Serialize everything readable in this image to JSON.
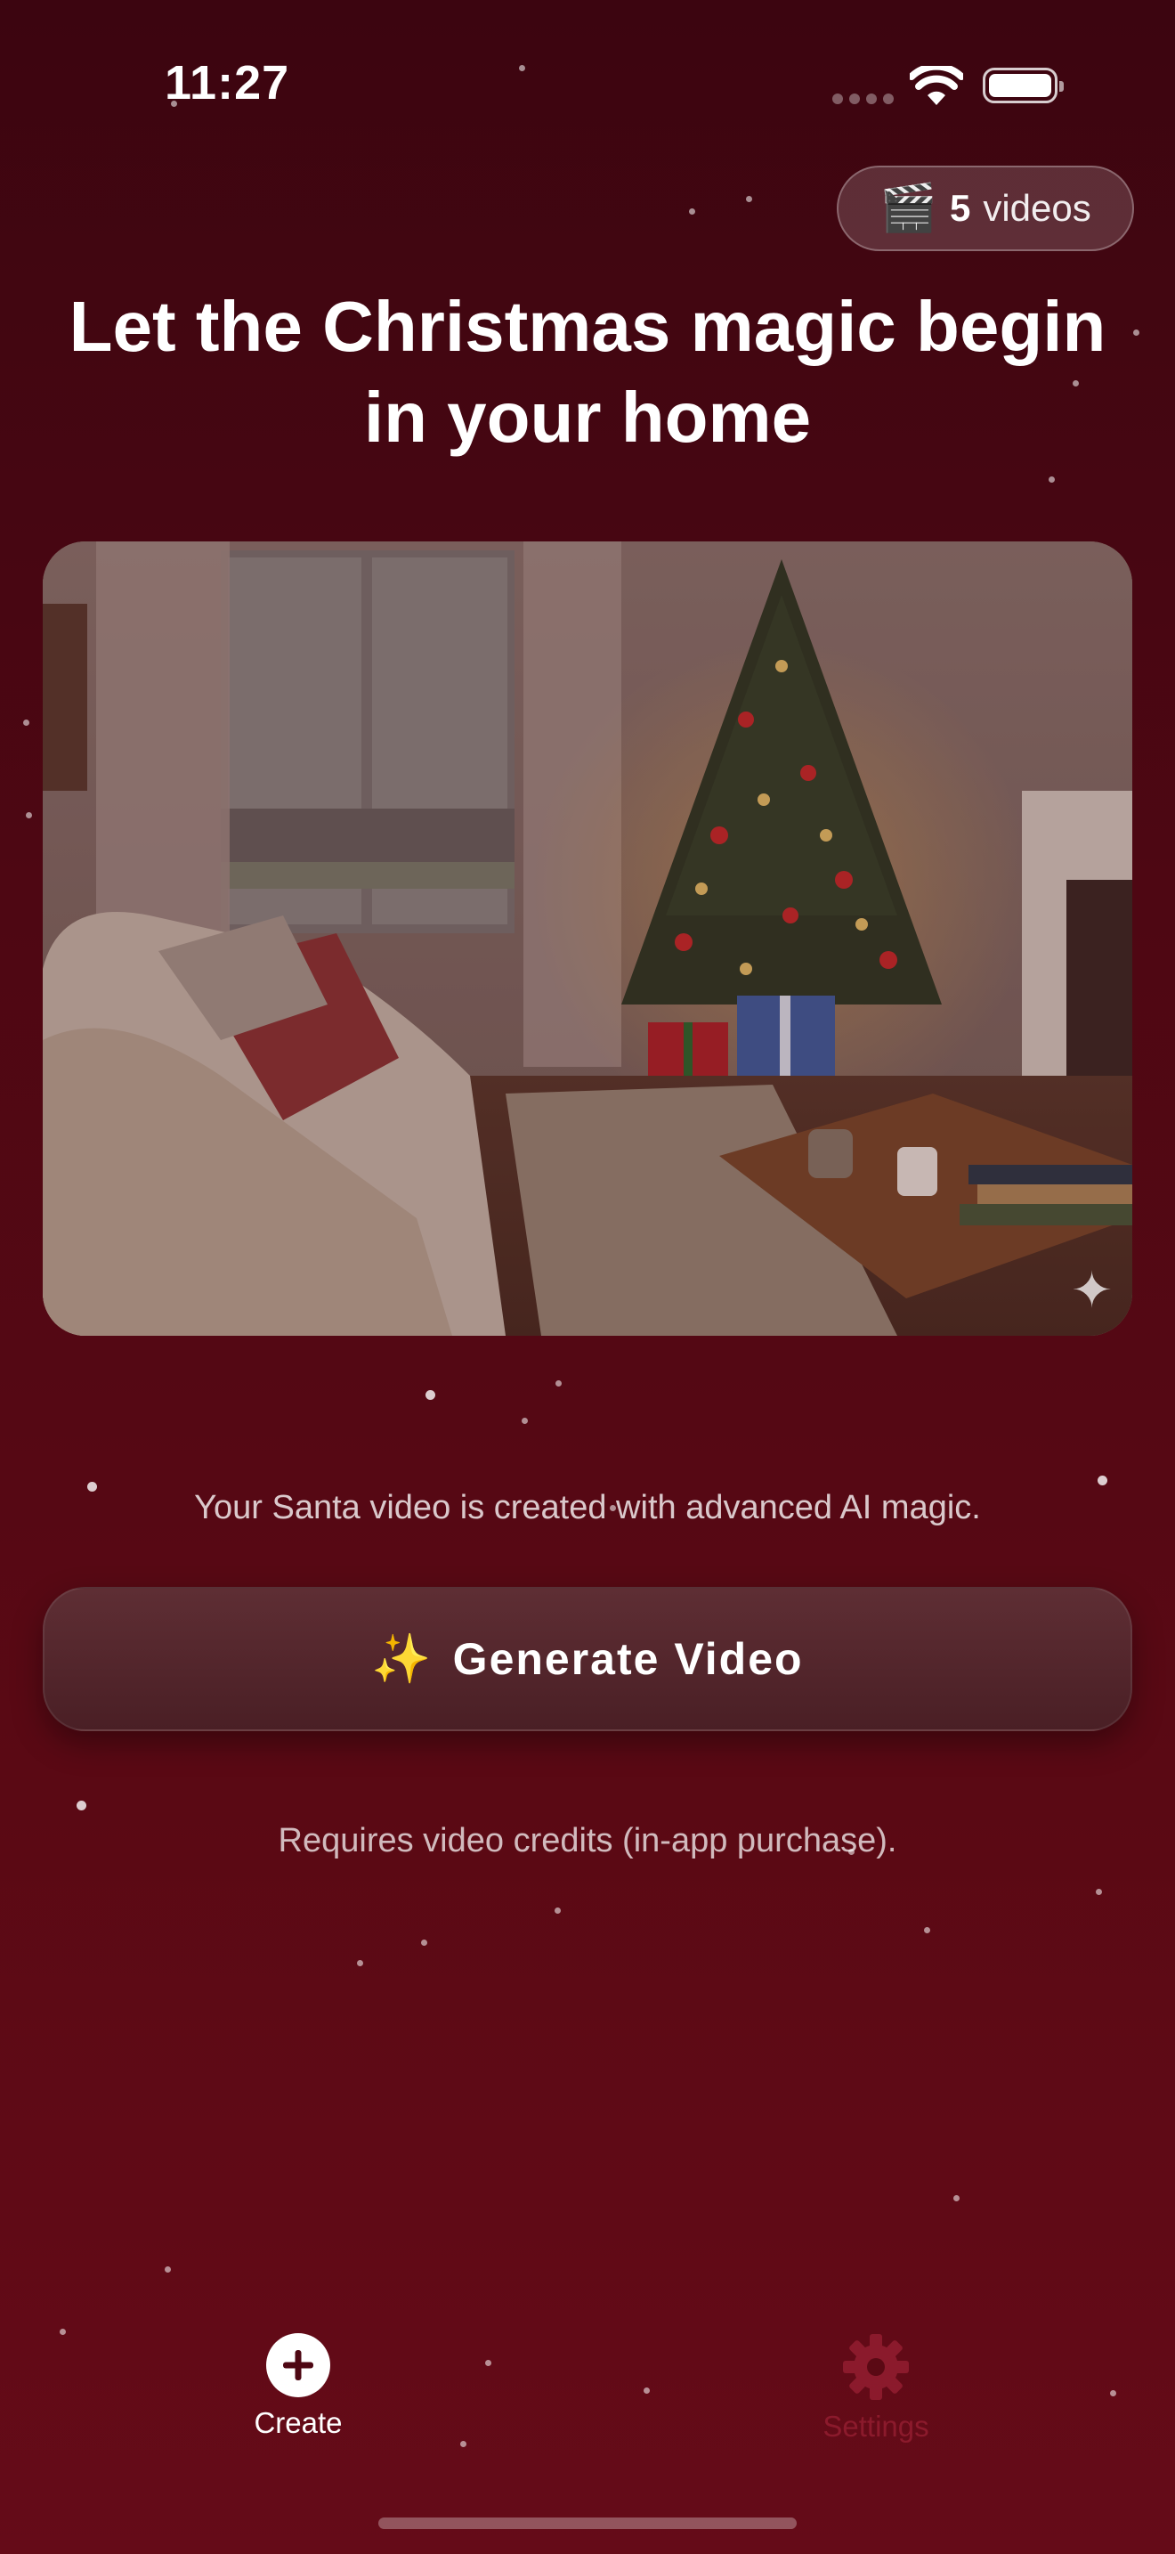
{
  "status_bar": {
    "time": "11:27"
  },
  "header": {
    "credits_icon": "clapperboard-icon",
    "credits_count": "5",
    "credits_unit": "videos"
  },
  "main": {
    "headline": "Let the Christmas magic begin in your home",
    "hero_image_description_icon": "sparkle-icon",
    "caption": "Your Santa video is created with advanced AI magic.",
    "generate_label": "Generate Video",
    "generate_icon": "sparkles-icon",
    "purchase_note": "Requires video credits (in-app purchase)."
  },
  "tab_bar": {
    "create_label": "Create",
    "settings_label": "Settings",
    "active_tab": "Create"
  },
  "colors": {
    "background_top": "#3c0510",
    "background_bottom": "#650b18",
    "accent_sparkle": "#ffd23a",
    "inactive_tab": "#8b1a2c"
  }
}
